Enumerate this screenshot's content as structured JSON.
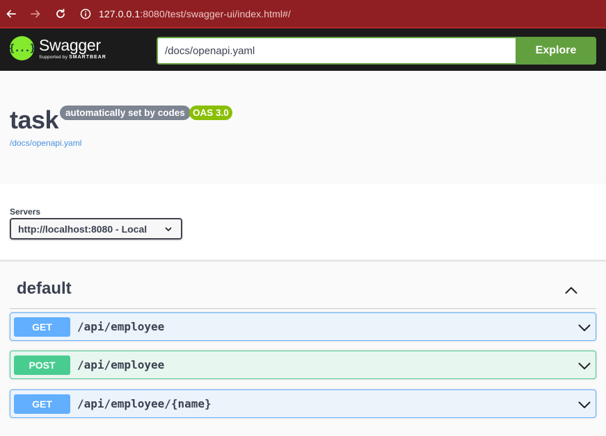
{
  "browser": {
    "url_host": "127.0.0.1",
    "url_rest": ":8080/test/swagger-ui/index.html#/"
  },
  "topbar": {
    "logo_name": "Swagger",
    "logo_supported": "Supported by",
    "logo_brand": "SMARTBEAR",
    "spec_url": "/docs/openapi.yaml",
    "explore_label": "Explore"
  },
  "info": {
    "title": "task",
    "version_badge": "automatically set by codes",
    "oas_badge": "OAS 3.0",
    "spec_link": "/docs/openapi.yaml"
  },
  "servers": {
    "label": "Servers",
    "selected": "http://localhost:8080 - Local"
  },
  "tag": {
    "name": "default"
  },
  "operations": [
    {
      "method": "GET",
      "path": "/api/employee"
    },
    {
      "method": "POST",
      "path": "/api/employee"
    },
    {
      "method": "GET",
      "path": "/api/employee/{name}"
    }
  ],
  "colors": {
    "browser_bar": "#8f1f22",
    "swagger_green": "#85ea2d",
    "explore_green": "#62a03f",
    "get_blue": "#61affe",
    "post_green": "#49cc90",
    "oas_badge": "#89bf04"
  }
}
